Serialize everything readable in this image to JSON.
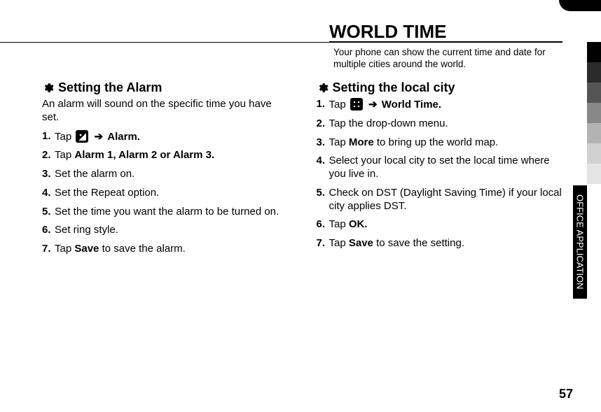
{
  "sideTab": "OFFICE APPLICATION",
  "pageNumber": "57",
  "worldTime": {
    "heading": "WORLD TIME",
    "sub": "Your phone can show the current time and date for multiple cities around the world."
  },
  "left": {
    "title": "Setting the Alarm",
    "desc": "An alarm will sound on the specific time you have set.",
    "steps": [
      {
        "num": "1.",
        "pre": "Tap",
        "icon": "pic",
        "arrow": "➔",
        "boldTail": "Alarm."
      },
      {
        "num": "2.",
        "pre": "Tap ",
        "bold": "Alarm 1, Alarm 2 or Alarm 3."
      },
      {
        "num": "3.",
        "text": "Set the alarm on."
      },
      {
        "num": "4.",
        "text": "Set the Repeat option."
      },
      {
        "num": "5.",
        "text": "Set the time you want the alarm to be turned on."
      },
      {
        "num": "6.",
        "text": "Set ring style."
      },
      {
        "num": "7.",
        "pre": "Tap ",
        "bold": "Save",
        "tail": " to save the alarm."
      }
    ]
  },
  "right": {
    "title": "Setting the local city",
    "steps": [
      {
        "num": "1.",
        "pre": "Tap",
        "icon": "grid",
        "arrow": "➔",
        "boldTail": "World Time."
      },
      {
        "num": "2.",
        "text": "Tap the drop-down menu."
      },
      {
        "num": "3.",
        "pre": "Tap ",
        "bold": "More",
        "tail": " to bring up the world map."
      },
      {
        "num": "4.",
        "text": "Select your local city to set the local time where you live in."
      },
      {
        "num": "5.",
        "text": "Check on DST (Daylight Saving Time) if your local city applies DST."
      },
      {
        "num": "6.",
        "pre": "Tap ",
        "bold": "OK."
      },
      {
        "num": "7.",
        "pre": "Tap ",
        "bold": "Save",
        "tail": " to save the setting."
      }
    ]
  }
}
